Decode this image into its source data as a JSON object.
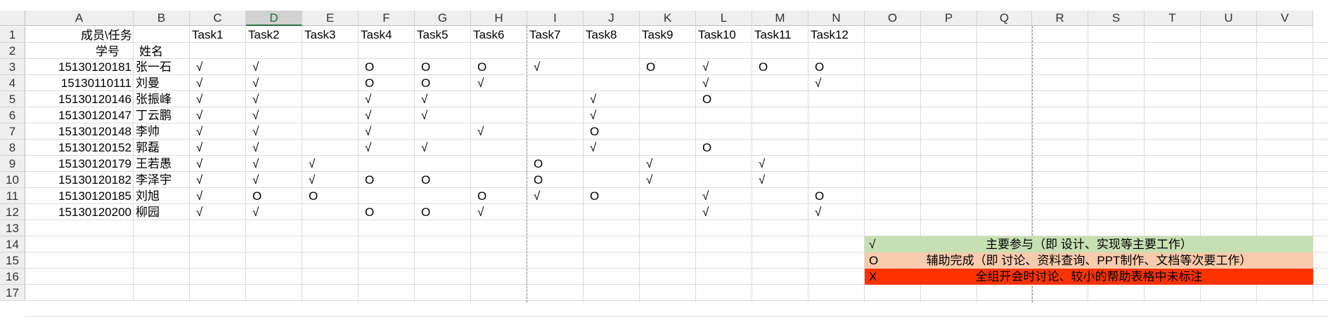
{
  "columns": [
    "A",
    "B",
    "C",
    "D",
    "E",
    "F",
    "G",
    "H",
    "I",
    "J",
    "K",
    "L",
    "M",
    "N",
    "O",
    "P",
    "Q",
    "R",
    "S",
    "T",
    "U",
    "V"
  ],
  "selected_column": "D",
  "row_numbers": [
    "1",
    "2",
    "3",
    "4",
    "5",
    "6",
    "7",
    "8",
    "9",
    "10",
    "11",
    "12",
    "13",
    "14",
    "15",
    "16",
    "17"
  ],
  "header_row": {
    "corner_label": "成员\\任务",
    "tasks": [
      "Task1",
      "Task2",
      "Task3",
      "Task4",
      "Task5",
      "Task6",
      "Task7",
      "Task8",
      "Task9",
      "Task10",
      "Task11",
      "Task12"
    ]
  },
  "subheader_row": {
    "id_label": "学号",
    "name_label": "姓名"
  },
  "members": [
    {
      "id": "15130120181",
      "name": "张一石",
      "marks": [
        "√",
        "√",
        "",
        "O",
        "O",
        "O",
        "√",
        "",
        "O",
        "√",
        "O",
        "O"
      ]
    },
    {
      "id": "15130110111",
      "name": "刘曼",
      "marks": [
        "√",
        "√",
        "",
        "O",
        "O",
        "√",
        "",
        "",
        "",
        "√",
        "",
        "√"
      ]
    },
    {
      "id": "15130120146",
      "name": "张振峰",
      "marks": [
        "√",
        "√",
        "",
        "√",
        "√",
        "",
        "",
        "√",
        "",
        "O",
        "",
        ""
      ]
    },
    {
      "id": "15130120147",
      "name": "丁云鹏",
      "marks": [
        "√",
        "√",
        "",
        "√",
        "√",
        "",
        "",
        "√",
        "",
        "",
        "",
        ""
      ]
    },
    {
      "id": "15130120148",
      "name": "李帅",
      "marks": [
        "√",
        "√",
        "",
        "√",
        "",
        "√",
        "",
        "O",
        "",
        "",
        "",
        ""
      ]
    },
    {
      "id": "15130120152",
      "name": "郭磊",
      "marks": [
        "√",
        "√",
        "",
        "√",
        "√",
        "",
        "",
        "√",
        "",
        "O",
        "",
        ""
      ]
    },
    {
      "id": "15130120179",
      "name": "王若愚",
      "marks": [
        "√",
        "√",
        "√",
        "",
        "",
        "",
        "O",
        "",
        "√",
        "",
        "√",
        ""
      ]
    },
    {
      "id": "15130120182",
      "name": "李泽宇",
      "marks": [
        "√",
        "√",
        "√",
        "O",
        "O",
        "",
        "O",
        "",
        "√",
        "",
        "√",
        ""
      ]
    },
    {
      "id": "15130120185",
      "name": "刘旭",
      "marks": [
        "√",
        "O",
        "O",
        "",
        "",
        "O",
        "√",
        "O",
        "",
        "√",
        "",
        "O"
      ]
    },
    {
      "id": "15130120200",
      "name": "柳园",
      "marks": [
        "√",
        "√",
        "",
        "O",
        "O",
        "√",
        "",
        "",
        "",
        "√",
        "",
        "√"
      ]
    }
  ],
  "legend": [
    {
      "symbol": "√",
      "text": "主要参与（即 设计、实现等主要工作）",
      "color": "#c6e0b4"
    },
    {
      "symbol": "O",
      "text": "辅助完成（即 讨论、资料查询、PPT制作、文档等次要工作）",
      "color": "#f8cbad"
    },
    {
      "symbol": "X",
      "text": "全组开会时讨论、较小的帮助表格中未标注",
      "color": "#ff3300"
    }
  ],
  "colors": {
    "header_bg": "#efefef",
    "selected_header_fg": "#217346",
    "gridline": "#dadada"
  }
}
